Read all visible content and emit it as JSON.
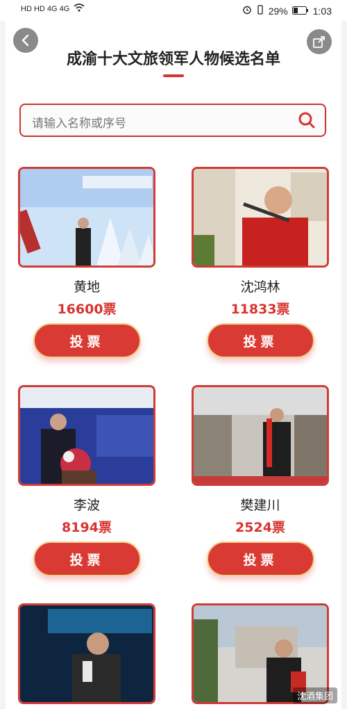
{
  "status_bar": {
    "left": "HD HD 4G 4G",
    "battery": "29%",
    "time": "1:03"
  },
  "page": {
    "title": "成渝十大文旅领军人物候选名单",
    "search_placeholder": "请输入名称或序号",
    "vote_label": "投票",
    "votes_suffix": "票"
  },
  "candidates": [
    {
      "name": "黄地",
      "votes": "16600票"
    },
    {
      "name": "沈鸿林",
      "votes": "11833票"
    },
    {
      "name": "李波",
      "votes": "8194票"
    },
    {
      "name": "樊建川",
      "votes": "2524票"
    },
    {
      "name": "",
      "votes": ""
    },
    {
      "name": "",
      "votes": ""
    }
  ],
  "watermark": "沈酒集团",
  "colors": {
    "accent": "#d8332f",
    "button": "#d93a33"
  }
}
